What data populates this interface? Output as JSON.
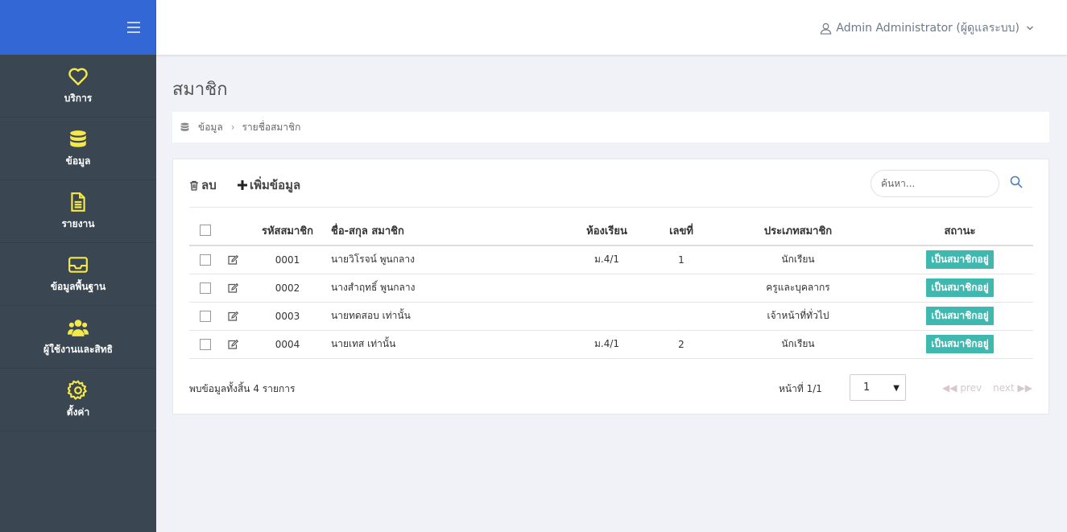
{
  "header": {
    "user_label": "Admin Administrator (ผู้ดูแลระบบ)"
  },
  "sidebar": {
    "items": [
      {
        "label": "บริการ",
        "icon": "heart-icon"
      },
      {
        "label": "ข้อมูล",
        "icon": "database-icon"
      },
      {
        "label": "รายงาน",
        "icon": "document-icon"
      },
      {
        "label": "ข้อมูลพื้นฐาน",
        "icon": "inbox-icon"
      },
      {
        "label": "ผู้ใช้งานและสิทธิ",
        "icon": "users-icon"
      },
      {
        "label": "ตั้งค่า",
        "icon": "gear-icon"
      }
    ]
  },
  "page": {
    "title": "สมาชิก"
  },
  "breadcrumb": {
    "items": [
      "ข้อมูล",
      "รายชื่อสมาชิก"
    ]
  },
  "toolbar": {
    "delete_label": "ลบ",
    "add_label": "เพิ่มข้อมูล",
    "search_placeholder": "ค้นหา..."
  },
  "table": {
    "headers": [
      "รหัสสมาชิก",
      "ชื่อ-สกุล สมาชิก",
      "ห้องเรียน",
      "เลขที่",
      "ประเภทสมาชิก",
      "สถานะ"
    ],
    "rows": [
      {
        "id": "0001",
        "name": "นายวิโรจน์ พูนกลาง",
        "room": "ม.4/1",
        "number": "1",
        "type": "นักเรียน",
        "status": "เป็นสมาชิกอยู่"
      },
      {
        "id": "0002",
        "name": "นางสำฤทธิ์ พูนกลาง",
        "room": "",
        "number": "",
        "type": "ครูและบุคลากร",
        "status": "เป็นสมาชิกอยู่"
      },
      {
        "id": "0003",
        "name": "นายทดสอบ เท่านั้น",
        "room": "",
        "number": "",
        "type": "เจ้าหน้าที่ทั่วไป",
        "status": "เป็นสมาชิกอยู่"
      },
      {
        "id": "0004",
        "name": "นายเทส เท่านั้น",
        "room": "ม.4/1",
        "number": "2",
        "type": "นักเรียน",
        "status": "เป็นสมาชิกอยู่"
      }
    ]
  },
  "footer": {
    "summary": "พบข้อมูลทั้งสิ้น 4 รายการ",
    "page_label": "หน้าที่ 1/1",
    "page_value": "1",
    "prev_label": "prev",
    "next_label": "next"
  },
  "colors": {
    "brand": "#3467d6",
    "sidebar": "#3a4651",
    "icon": "#f5e94a",
    "badge": "#3fb8af"
  }
}
